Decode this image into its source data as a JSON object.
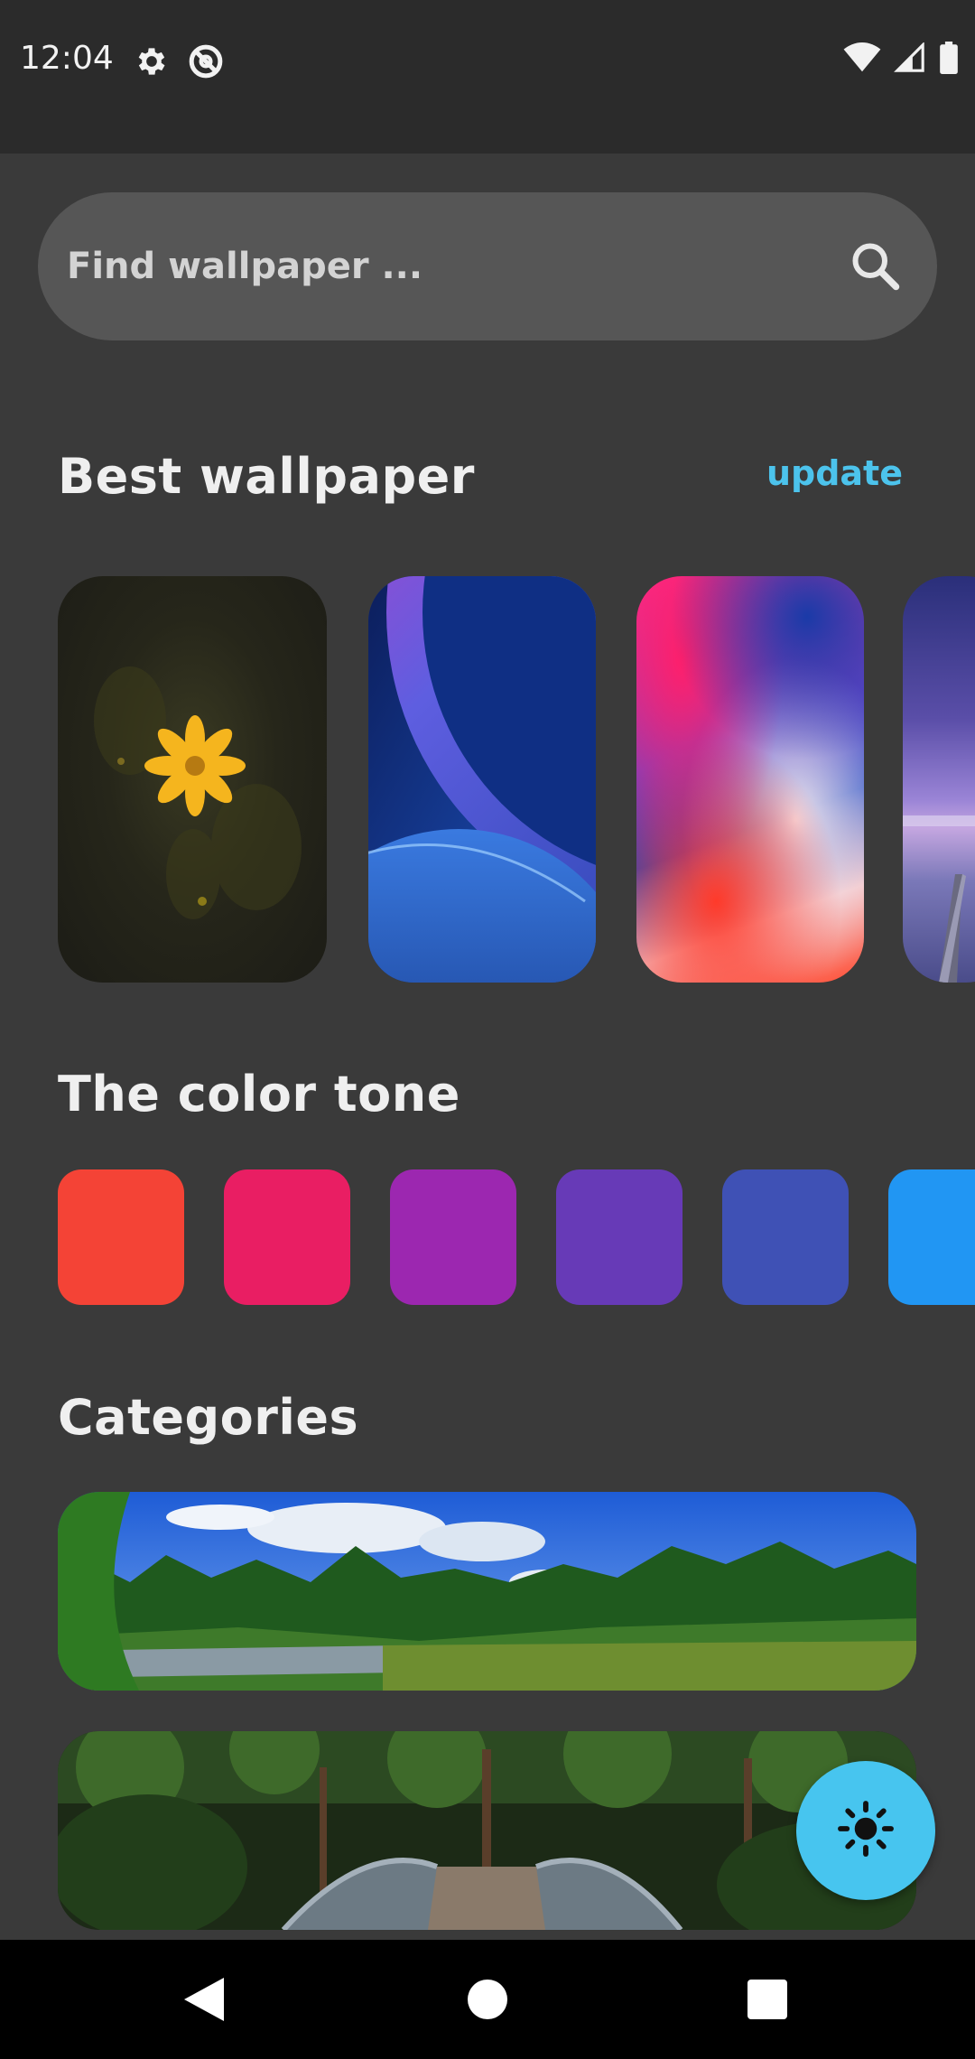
{
  "status_bar": {
    "time": "12:04",
    "left_icons": [
      "gear-icon",
      "at-sign-icon"
    ],
    "right_icons": [
      "wifi-icon",
      "cell-signal-icon",
      "battery-icon"
    ]
  },
  "search": {
    "placeholder": "Find wallpaper ...",
    "icon": "search-icon"
  },
  "best_wallpaper": {
    "title": "Best wallpaper",
    "action_label": "update",
    "accent_color": "#4cc3ec",
    "items": [
      "yellow-flower-wallpaper",
      "blue-planet-wallpaper",
      "gradient-color-wallpaper",
      "purple-lake-pier-wallpaper"
    ]
  },
  "color_tone": {
    "title": "The color tone",
    "colors": [
      "#f44336",
      "#e91e63",
      "#9c27b0",
      "#673ab7",
      "#3f51b5",
      "#2196f3"
    ]
  },
  "categories": {
    "title": "Categories",
    "items": [
      "forest-lake-category",
      "forest-bridge-category"
    ]
  },
  "fab": {
    "icon": "sun-icon",
    "color": "#47c5ef"
  },
  "nav_bar": {
    "buttons": [
      "back-icon",
      "home-icon",
      "recents-icon"
    ]
  }
}
